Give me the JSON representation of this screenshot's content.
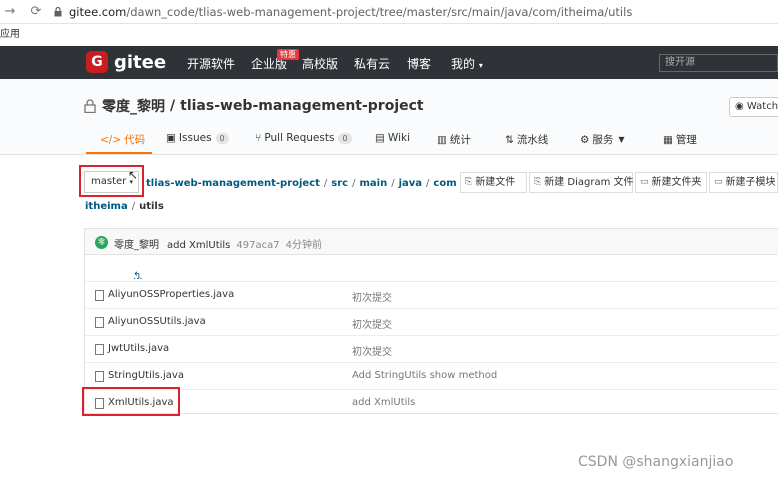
{
  "browser": {
    "url_domain": "gitee.com",
    "url_path": "/dawn_code/tlias-web-management-project/tree/master/src/main/java/com/itheima/utils",
    "apps_label": "应用"
  },
  "gitee_nav": {
    "logo_text": "gitee",
    "items": [
      "开源软件",
      "企业版",
      "高校版",
      "私有云",
      "博客",
      "我的"
    ],
    "special_badge": "特惠",
    "search_placeholder": "搜开源"
  },
  "project": {
    "owner": "零度_黎明",
    "sep": "/",
    "name": "tlias-web-management-project",
    "watch_label": "Watchi",
    "tabs": [
      {
        "label": "代码",
        "count": ""
      },
      {
        "label": "Issues",
        "count": "0"
      },
      {
        "label": "Pull Requests",
        "count": "0"
      },
      {
        "label": "Wiki",
        "count": ""
      },
      {
        "label": "统计",
        "count": ""
      },
      {
        "label": "流水线",
        "count": ""
      },
      {
        "label": "服务",
        "count": ""
      },
      {
        "label": "管理",
        "count": ""
      }
    ]
  },
  "breadcrumb": {
    "branch": "master",
    "path": [
      "tlias-web-management-project",
      "src",
      "main",
      "java",
      "com",
      "itheima",
      "utils"
    ]
  },
  "actions": [
    "新建文件",
    "新建 Diagram 文件",
    "新建文件夹",
    "新建子模块"
  ],
  "commit": {
    "avatar": "零",
    "author": "零度_黎明",
    "message": "add XmlUtils",
    "sha": "497aca7",
    "time": "4分钟前"
  },
  "back_link": "...",
  "files": [
    {
      "name": "AliyunOSSProperties.java",
      "message": "初次提交"
    },
    {
      "name": "AliyunOSSUtils.java",
      "message": "初次提交"
    },
    {
      "name": "JwtUtils.java",
      "message": "初次提交"
    },
    {
      "name": "StringUtils.java",
      "message": "Add StringUtils show method"
    },
    {
      "name": "XmlUtils.java",
      "message": "add XmlUtils"
    }
  ],
  "watermark": "CSDN @shangxianjiao"
}
